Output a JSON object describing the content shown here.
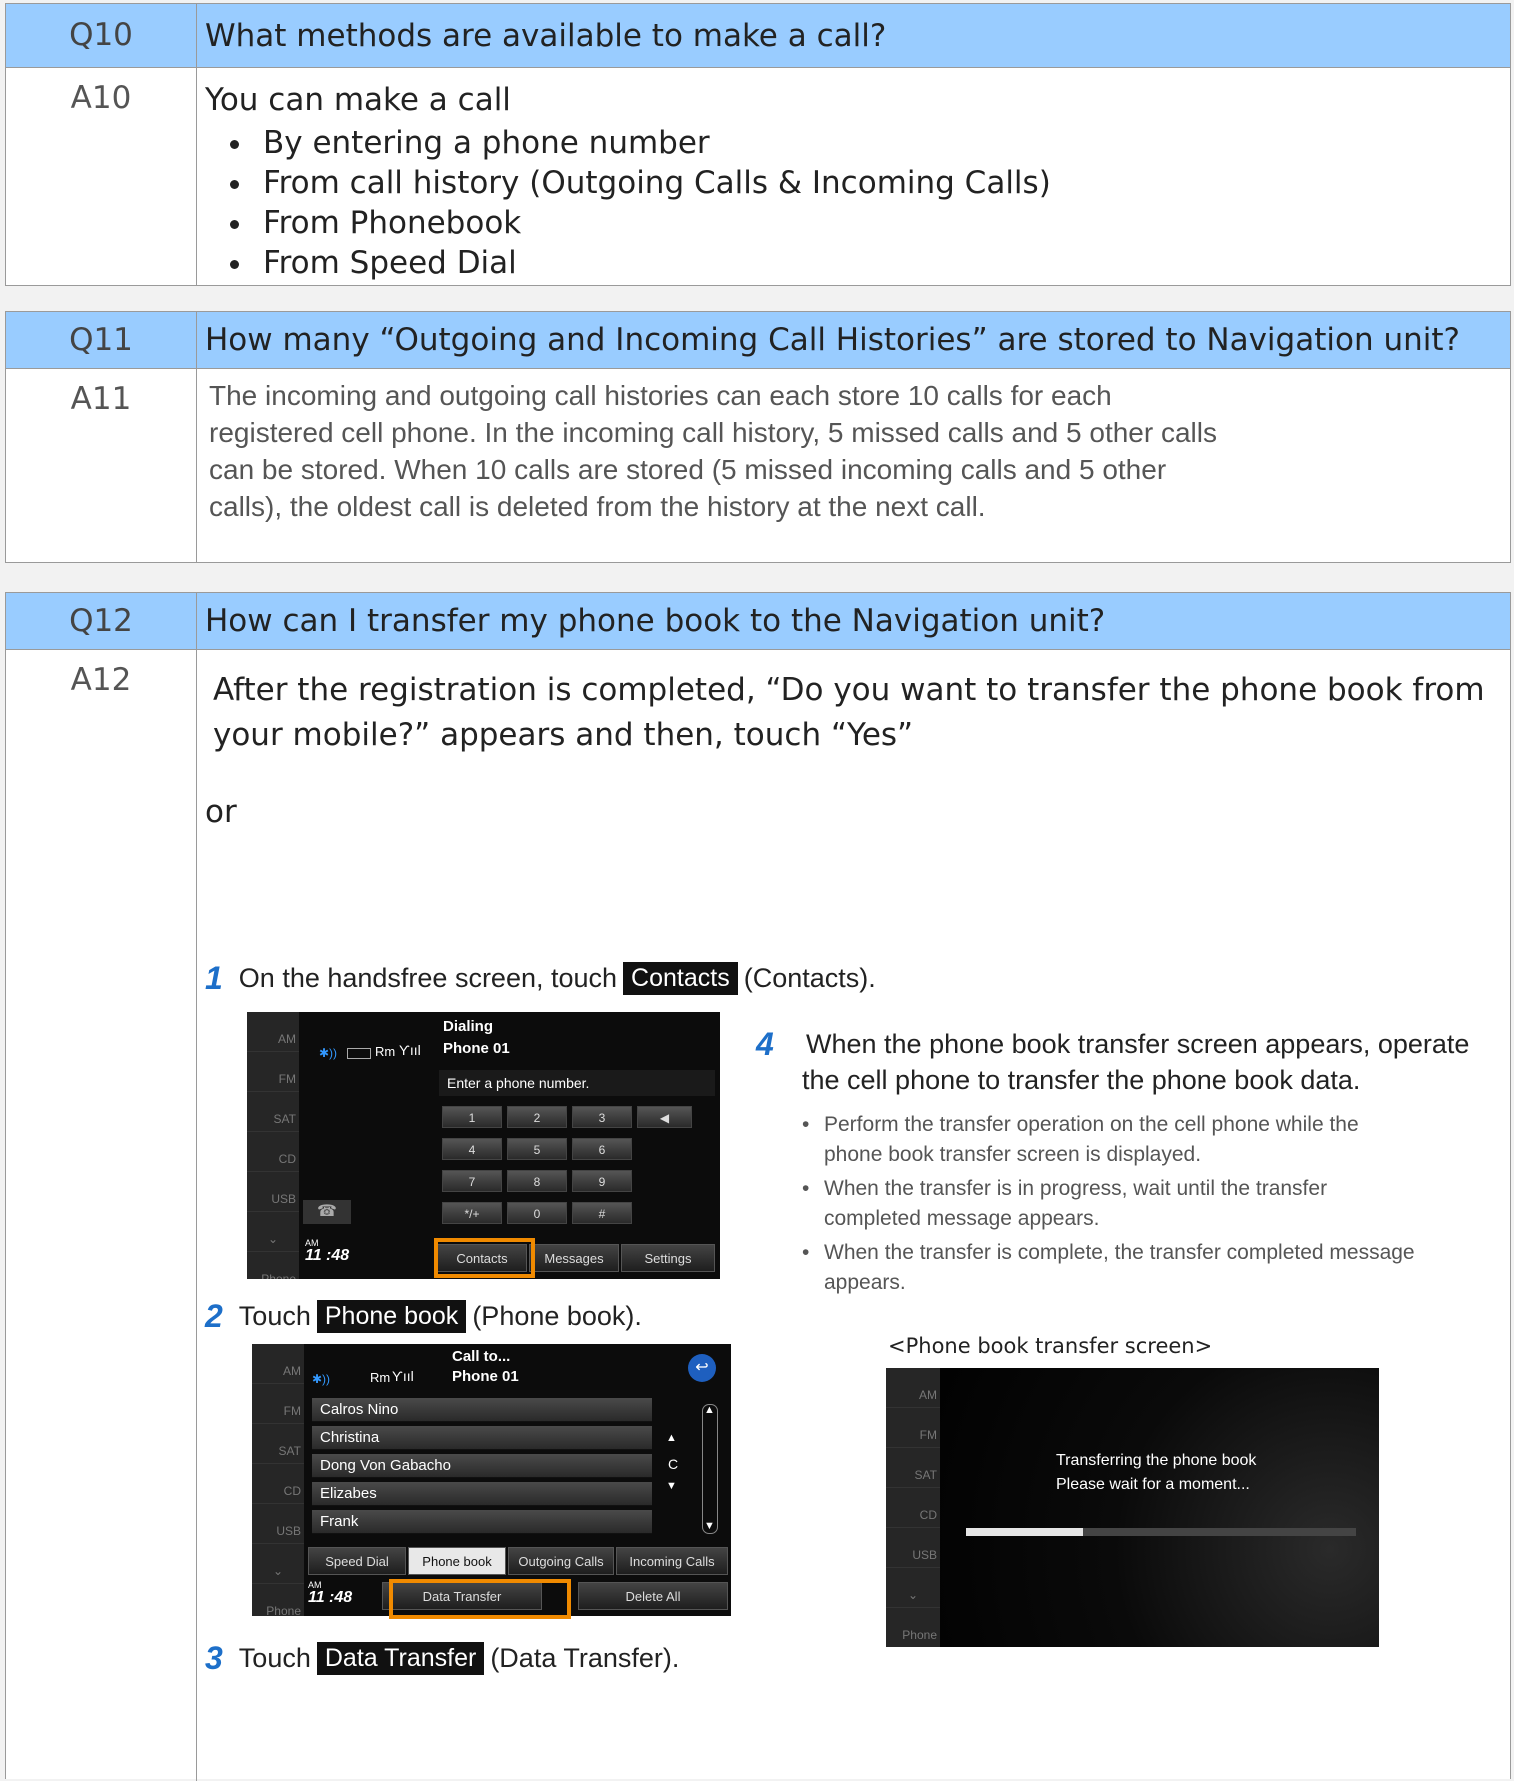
{
  "q10": {
    "num": "Q10",
    "question": "What methods are available to make a call?",
    "anum": "A10",
    "intro": "You can make a call",
    "items": [
      "By entering a phone number",
      "From call history (Outgoing Calls & Incoming Calls)",
      "From Phonebook",
      "From Speed Dial"
    ]
  },
  "q11": {
    "num": "Q11",
    "question": "How many “Outgoing and Incoming Call Histories” are stored to Navigation unit?",
    "anum": "A11",
    "lines": [
      "The incoming and outgoing call histories can each store 10 calls for each",
      "registered cell phone. In the incoming call history, 5 missed calls and 5 other calls",
      "can be stored. When 10 calls are stored (5 missed incoming calls and 5 other",
      "calls), the oldest call is deleted from the history at the next call."
    ]
  },
  "q12": {
    "num": "Q12",
    "question": "How can I transfer my phone book to the Navigation unit?",
    "anum": "A12",
    "para1": "After the registration is completed, “Do you want to transfer the phone book from",
    "para2": "your mobile?” appears and then, touch “Yes”",
    "or": "or",
    "step1": {
      "num": "1",
      "pre": "On the handsfree screen, touch",
      "chip": "Contacts",
      "post": "(Contacts)."
    },
    "step2": {
      "num": "2",
      "pre": "Touch",
      "chip": "Phone book",
      "post": "(Phone book)."
    },
    "step3": {
      "num": "3",
      "pre": "Touch",
      "chip": "Data Transfer",
      "post": "(Data Transfer)."
    },
    "step4": {
      "num": "4",
      "line1": "When the phone book transfer screen appears, operate",
      "line2": "the cell phone to transfer the phone book data.",
      "bullets": [
        [
          "Perform the transfer operation on the cell phone while the",
          "phone book transfer screen is displayed."
        ],
        [
          "When the transfer is in progress, wait until the transfer",
          "completed message appears."
        ],
        [
          "When the transfer is complete, the transfer completed message",
          "appears."
        ]
      ],
      "caption": "<Phone book transfer screen>"
    }
  },
  "screen1": {
    "title": "Dialing",
    "phone": "Phone 01",
    "status": "Rm",
    "prompt": "Enter a phone number.",
    "keys": [
      "1",
      "2",
      "3",
      "4",
      "5",
      "6",
      "7",
      "8",
      "9",
      "*/+",
      "0",
      "#"
    ],
    "tabs": [
      "Contacts",
      "Messages",
      "Settings"
    ],
    "ampm": "AM",
    "time": "11 :48",
    "side": [
      "AM",
      "FM",
      "SAT",
      "CD",
      "USB",
      "",
      "Phone"
    ]
  },
  "screen2": {
    "title": "Call to...",
    "phone": "Phone 01",
    "status": "Rm",
    "contacts": [
      "Calros Nino",
      "Christina",
      "Dong Von Gabacho",
      "Elizabes",
      "Frank"
    ],
    "index_letter": "C",
    "tabs": [
      "Speed Dial",
      "Phone book",
      "Outgoing Calls",
      "Incoming Calls"
    ],
    "buttons": [
      "Data Transfer",
      "Delete All"
    ],
    "ampm": "AM",
    "time": "11 :48",
    "side": [
      "AM",
      "FM",
      "SAT",
      "CD",
      "USB",
      "",
      "Phone"
    ],
    "selected_tab": "Phone book"
  },
  "screen3": {
    "line1": "Transferring the phone book",
    "line2": "Please wait for a moment...",
    "progress": 0.3,
    "side": [
      "AM",
      "FM",
      "SAT",
      "CD",
      "USB",
      "",
      "Phone"
    ]
  },
  "colors": {
    "header_bg": "#99ccff",
    "highlight": "#f08a00",
    "step_number": "#1d6fc9"
  }
}
